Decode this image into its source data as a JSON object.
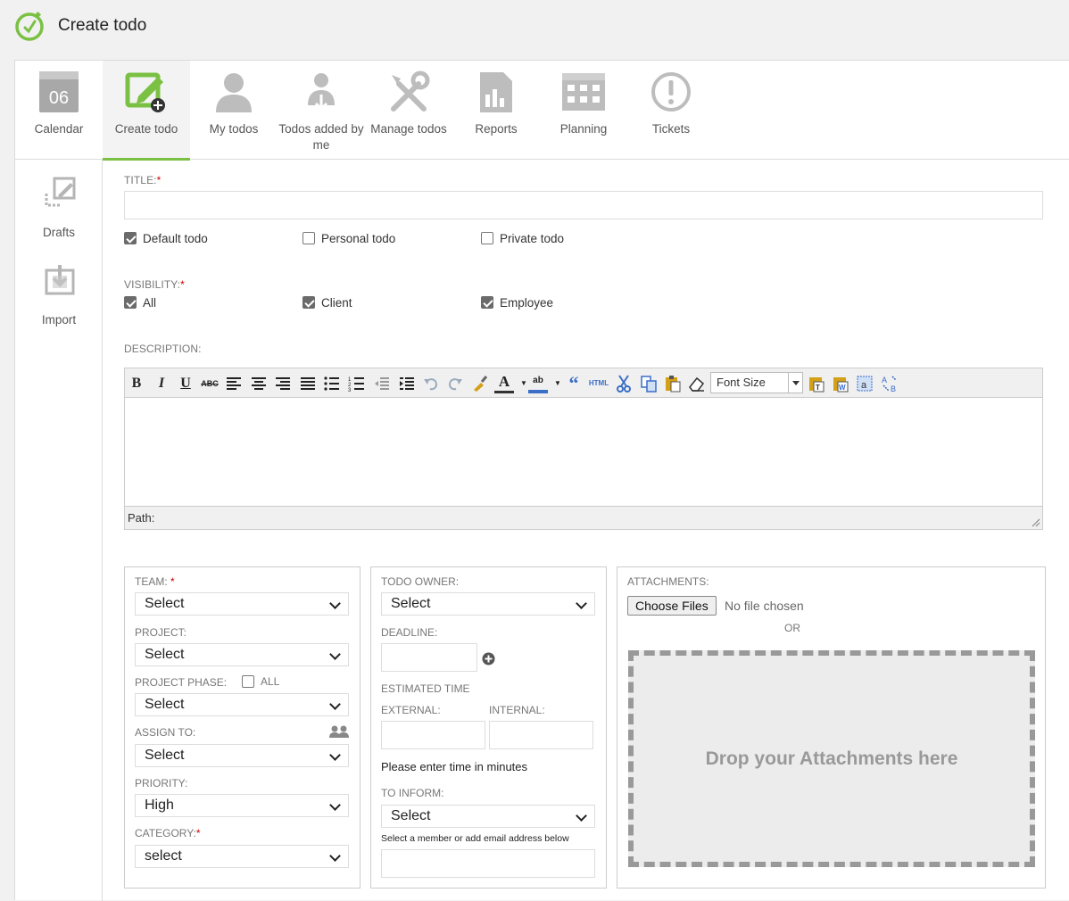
{
  "header": {
    "title": "Create todo",
    "logo_icon": "stopwatch-check-icon",
    "accent": "#7ac143"
  },
  "tabs": [
    {
      "label": "Calendar",
      "icon": "calendar-icon",
      "badge": "06"
    },
    {
      "label": "Create todo",
      "icon": "create-todo-icon",
      "active": true
    },
    {
      "label": "My todos",
      "icon": "user-icon"
    },
    {
      "label": "Todos added by me",
      "icon": "user-download-icon"
    },
    {
      "label": "Manage todos",
      "icon": "tools-icon"
    },
    {
      "label": "Reports",
      "icon": "report-icon"
    },
    {
      "label": "Planning",
      "icon": "planning-calendar-icon"
    },
    {
      "label": "Tickets",
      "icon": "exclamation-icon"
    }
  ],
  "sidebar": [
    {
      "label": "Drafts",
      "icon": "drafts-icon"
    },
    {
      "label": "Import",
      "icon": "import-icon"
    }
  ],
  "form": {
    "title_label": "TITLE:",
    "title_value": "",
    "required_mark": "*",
    "todo_types": [
      {
        "label": "Default todo",
        "checked": true
      },
      {
        "label": "Personal todo",
        "checked": false
      },
      {
        "label": "Private todo",
        "checked": false
      }
    ],
    "visibility_label": "VISIBILITY:",
    "visibility": [
      {
        "label": "All",
        "checked": true
      },
      {
        "label": "Client",
        "checked": true
      },
      {
        "label": "Employee",
        "checked": true
      }
    ],
    "description_label": "DESCRIPTION:",
    "editor": {
      "font_size_placeholder": "Font Size",
      "path_label": "Path:"
    }
  },
  "left_panel": {
    "team_label": "TEAM:",
    "team_value": "Select",
    "project_label": "PROJECT:",
    "project_value": "Select",
    "phase_label": "PROJECT PHASE:",
    "phase_all_label": "ALL",
    "phase_all_checked": false,
    "phase_value": "Select",
    "assign_label": "ASSIGN TO:",
    "assign_value": "Select",
    "priority_label": "PRIORITY:",
    "priority_value": "High",
    "category_label": "CATEGORY:",
    "category_value": "select"
  },
  "middle_panel": {
    "owner_label": "TODO OWNER:",
    "owner_value": "Select",
    "deadline_label": "DEADLINE:",
    "deadline_value": "",
    "est_label": "ESTIMATED TIME",
    "external_label": "EXTERNAL:",
    "internal_label": "INTERNAL:",
    "minutes_note": "Please enter time in minutes",
    "inform_label": "TO INFORM:",
    "inform_value": "Select",
    "inform_note": "Select a member or add email address below",
    "email_value": ""
  },
  "right_panel": {
    "attachments_label": "ATTACHMENTS:",
    "choose_files": "Choose Files",
    "no_file": "No file chosen",
    "or": "OR",
    "drop_text": "Drop your Attachments here"
  }
}
